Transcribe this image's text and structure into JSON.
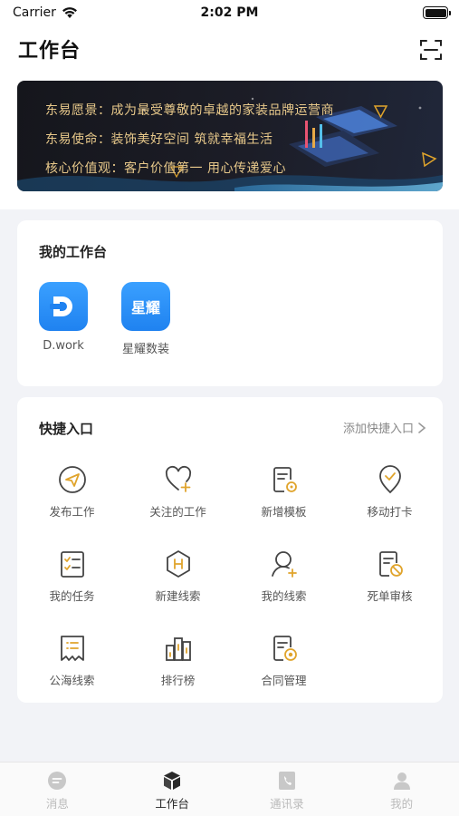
{
  "status_bar": {
    "carrier": "Carrier",
    "time": "2:02 PM",
    "battery_percent": 100
  },
  "header": {
    "title": "工作台",
    "scan_icon": "scan-icon"
  },
  "banner": {
    "lines": [
      "东易愿景：成为最受尊敬的卓越的家装品牌运营商",
      "东易使命：装饰美好空间 筑就幸福生活",
      "核心价值观：客户价值第一 用心传递爱心"
    ],
    "text_color": "#e7c88a"
  },
  "my_workbench": {
    "title": "我的工作台",
    "apps": [
      {
        "label": "D.work",
        "icon": "dwork-logo-icon",
        "icon_text": ""
      },
      {
        "label": "星耀数装",
        "icon": "xingyao-logo-icon",
        "icon_text": "星耀"
      }
    ]
  },
  "shortcuts": {
    "title": "快捷入口",
    "add_label": "添加快捷入口",
    "items": [
      {
        "label": "发布工作",
        "icon": "paper-plane-icon"
      },
      {
        "label": "关注的工作",
        "icon": "heart-plus-icon"
      },
      {
        "label": "新增模板",
        "icon": "document-gear-icon"
      },
      {
        "label": "移动打卡",
        "icon": "location-check-icon"
      },
      {
        "label": "我的任务",
        "icon": "task-list-icon"
      },
      {
        "label": "新建线索",
        "icon": "hexagon-lead-icon"
      },
      {
        "label": "我的线索",
        "icon": "person-plus-icon"
      },
      {
        "label": "死单审核",
        "icon": "document-block-icon"
      },
      {
        "label": "公海线索",
        "icon": "sea-list-icon"
      },
      {
        "label": "排行榜",
        "icon": "bar-ranking-icon"
      },
      {
        "label": "合同管理",
        "icon": "contract-icon"
      }
    ]
  },
  "tab_bar": {
    "tabs": [
      {
        "label": "消息",
        "icon": "message-icon",
        "active": false
      },
      {
        "label": "工作台",
        "icon": "cube-icon",
        "active": true
      },
      {
        "label": "通讯录",
        "icon": "phone-book-icon",
        "active": false
      },
      {
        "label": "我的",
        "icon": "profile-icon",
        "active": false
      }
    ]
  },
  "colors": {
    "accent_gold": "#e0a42c",
    "brand_blue": "#1f82f0",
    "tab_inactive": "#bbbbbb"
  }
}
